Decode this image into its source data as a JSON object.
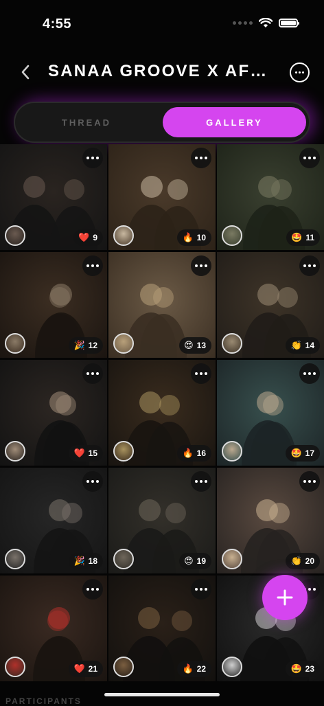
{
  "status_bar": {
    "time": "4:55"
  },
  "header": {
    "title": "SANAA GROOVE X AF…"
  },
  "tabs": [
    {
      "label": "THREAD",
      "selected": false
    },
    {
      "label": "GALLERY",
      "selected": true
    }
  ],
  "gallery": {
    "tiles": [
      {
        "reaction_icon": "heart",
        "emoji": "❤️",
        "count": "9"
      },
      {
        "reaction_icon": "fire",
        "emoji": "🔥",
        "count": "10"
      },
      {
        "reaction_icon": "star-struck",
        "emoji": "🤩",
        "count": "11"
      },
      {
        "reaction_icon": "party-popper",
        "emoji": "🎉",
        "count": "12"
      },
      {
        "reaction_icon": "heart-eyes",
        "emoji": "😍",
        "count": "13"
      },
      {
        "reaction_icon": "hands-clapping",
        "emoji": "👏",
        "count": "14"
      },
      {
        "reaction_icon": "heart",
        "emoji": "❤️",
        "count": "15"
      },
      {
        "reaction_icon": "fire",
        "emoji": "🔥",
        "count": "16"
      },
      {
        "reaction_icon": "star-struck",
        "emoji": "🤩",
        "count": "17"
      },
      {
        "reaction_icon": "party-popper",
        "emoji": "🎉",
        "count": "18"
      },
      {
        "reaction_icon": "heart-eyes",
        "emoji": "😍",
        "count": "19"
      },
      {
        "reaction_icon": "hands-clapping",
        "emoji": "👏",
        "count": "20"
      },
      {
        "reaction_icon": "heart",
        "emoji": "❤️",
        "count": "21"
      },
      {
        "reaction_icon": "fire",
        "emoji": "🔥",
        "count": "22"
      },
      {
        "reaction_icon": "star-struck",
        "emoji": "🤩",
        "count": "23"
      }
    ]
  },
  "section_peek": "PARTICIPANTS",
  "colors": {
    "accent": "#d545ef",
    "background": "#050505",
    "segment_bg": "#181818"
  }
}
